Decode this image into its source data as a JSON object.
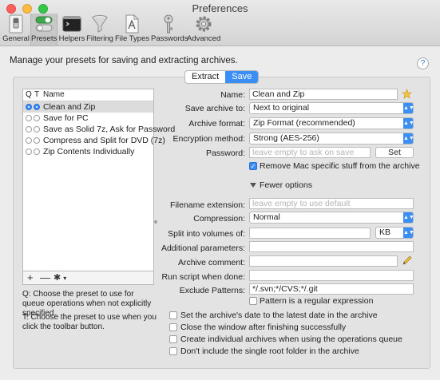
{
  "window": {
    "title": "Preferences"
  },
  "toolbar": {
    "items": [
      {
        "label": "General",
        "icon": "switch-icon"
      },
      {
        "label": "Presets",
        "icon": "toggles-icon"
      },
      {
        "label": "Helpers",
        "icon": "terminal-icon"
      },
      {
        "label": "Filtering",
        "icon": "funnel-icon"
      },
      {
        "label": "File Types",
        "icon": "document-icon"
      },
      {
        "label": "Passwords",
        "icon": "key-icon"
      },
      {
        "label": "Advanced",
        "icon": "gear-icon"
      }
    ],
    "selected": "Presets"
  },
  "intro": "Manage your presets for saving and extracting archives.",
  "help": "?",
  "segment": {
    "extract": "Extract",
    "save": "Save"
  },
  "presets": {
    "headers": {
      "q": "Q",
      "t": "T",
      "name": "Name"
    },
    "rows": [
      {
        "name": "Clean and Zip",
        "q": true,
        "t": true,
        "selected": true
      },
      {
        "name": "Save for PC",
        "q": false,
        "t": false
      },
      {
        "name": "Save as Solid 7z, Ask for Password",
        "q": false,
        "t": false
      },
      {
        "name": "Compress and Split for DVD (7z)",
        "q": false,
        "t": false
      },
      {
        "name": "Zip Contents Individually",
        "q": false,
        "t": false
      }
    ],
    "footer": {
      "add": "+",
      "remove": "—",
      "actions": "✱"
    }
  },
  "notes": {
    "q": "Q: Choose the preset to use for queue operations when not explicitly specified.",
    "t": "T: Choose the preset to use when you click the toolbar button."
  },
  "form": {
    "name_label": "Name:",
    "name_value": "Clean and Zip",
    "save_to_label": "Save archive to:",
    "save_to_value": "Next to original",
    "format_label": "Archive format:",
    "format_value": "Zip Format (recommended)",
    "encryption_label": "Encryption method:",
    "encryption_value": "Strong (AES-256)",
    "password_label": "Password:",
    "password_placeholder": "leave empty to ask on save",
    "set_button": "Set",
    "remove_mac_label": "Remove Mac specific stuff from the archive",
    "fewer_options": "Fewer options",
    "ext_label": "Filename extension:",
    "ext_placeholder": "leave empty to use default",
    "compression_label": "Compression:",
    "compression_value": "Normal",
    "split_label": "Split into volumes of:",
    "split_unit": "KB",
    "params_label": "Additional parameters:",
    "comment_label": "Archive comment:",
    "script_label": "Run script when done:",
    "exclude_label": "Exclude Patterns:",
    "exclude_value": "*/.svn;*/CVS;*/.git",
    "regex_label": "Pattern is a regular expression"
  },
  "options": [
    "Set the archive's date to the latest date in the archive",
    "Close the window after finishing successfully",
    "Create individual archives when using the operations queue",
    "Don't include the single root folder in the archive"
  ],
  "colors": {
    "accent": "#3b8ef5"
  }
}
